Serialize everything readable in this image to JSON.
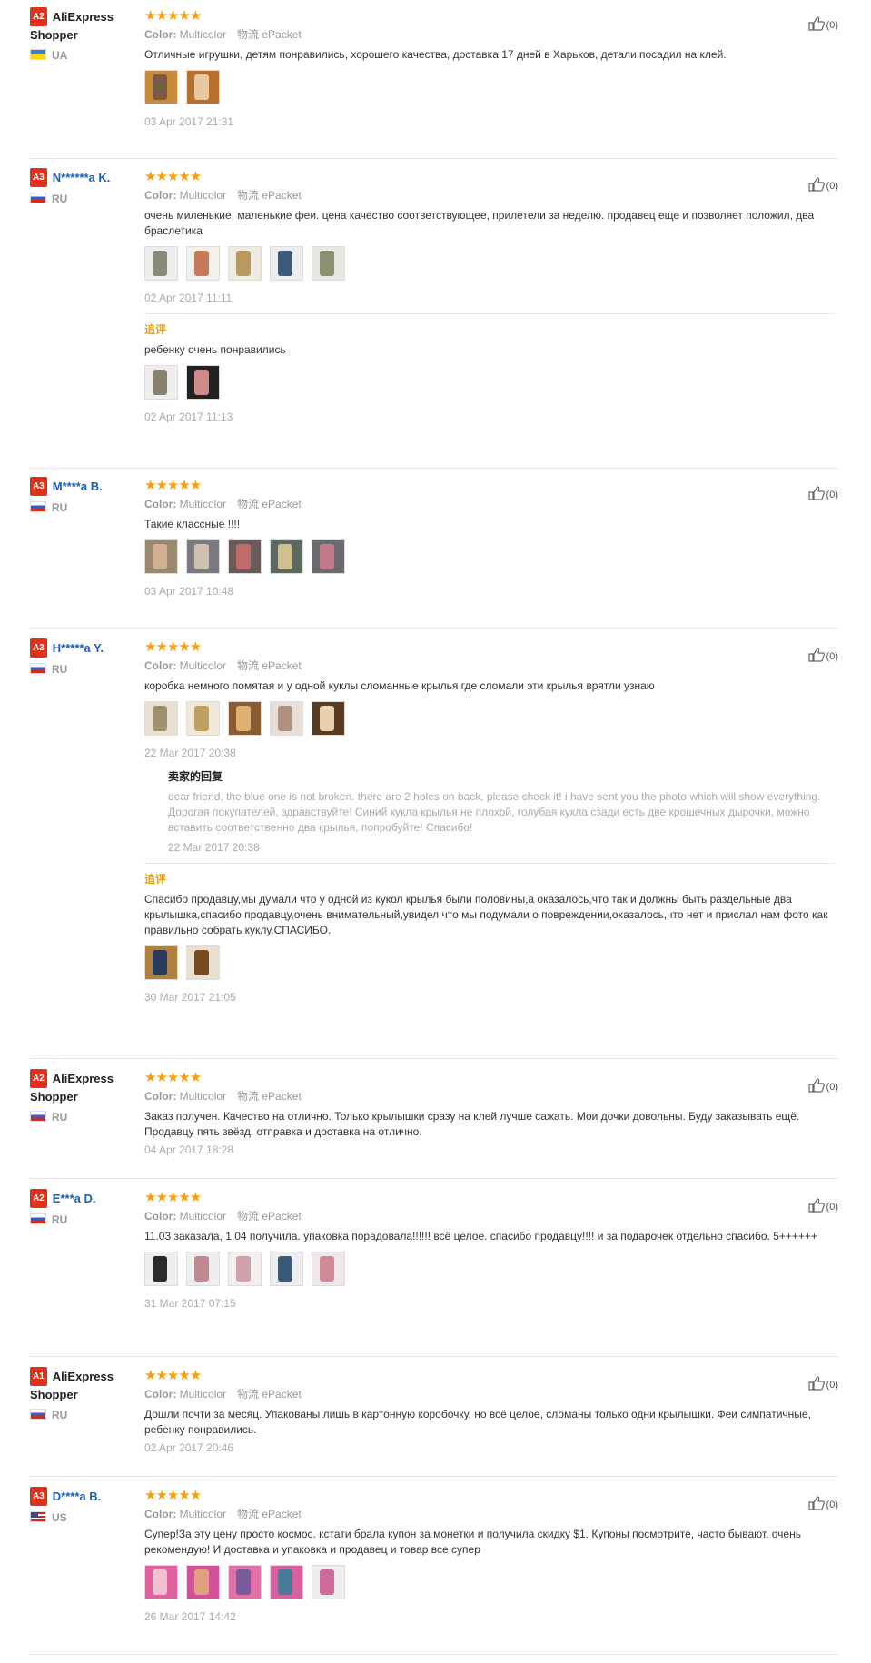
{
  "labels": {
    "color": "Color:",
    "color_value": "Multicolor",
    "logistics": "物流 ePacket",
    "likes": "(0)",
    "additional": "追评",
    "seller_reply": "卖家的回复"
  },
  "reviews": [
    {
      "level": "A2",
      "name": "AliExpress Shopper",
      "country": "UA",
      "text": "Отличные игрушки, детям понравились, хорошего качества, доставка 17 дней в Харьков, детали посадил на клей.",
      "date": "03 Apr 2017 21:31"
    },
    {
      "level": "A3",
      "name": "N******a K.",
      "country": "RU",
      "text": "очень миленькие, маленькие феи. цена качество соответствующее, прилетели за неделю. продавец еще и позволяет положил, два браслетика",
      "date": "02 Apr 2017 11:11",
      "add_text": "ребенку очень понравились",
      "add_date": "02 Apr 2017 11:13"
    },
    {
      "level": "A3",
      "name": "M****a B.",
      "country": "RU",
      "text": "Такие классные !!!!",
      "date": "03 Apr 2017 10:48"
    },
    {
      "level": "A3",
      "name": "H*****a Y.",
      "country": "RU",
      "text": "коробка немного помятая и у одной куклы сломанные крылья где сломали эти крылья врятли узнаю",
      "date": "22 Mar 2017 20:38",
      "reply_text": "dear friend, the blue one is not broken. there are 2 holes on back, please check it! i have sent you the photo which will show everything. Дорогая покупателей, здравствуйте! Синий кукла крылья не плохой, голубая кукла сзади есть две крошечных дырочки, можно вставить соответственно два крылья, попробуйте! Спасибо!",
      "reply_date": "22 Mar 2017 20:38",
      "add_text": "Спасибо продавцу,мы думали что у одной из кукол крылья были половины,а оказалось,что так и должны быть раздельные два крылышка,спасибо продавцу,очень внимательный,увидел что мы подумали о повреждении,оказалось,что нет и прислал нам фото как правильно собрать куклу.СПАСИБО.",
      "add_date": "30 Mar 2017 21:05"
    },
    {
      "level": "A2",
      "name": "AliExpress Shopper",
      "country": "RU",
      "text": "Заказ получен. Качество на отлично. Только крылышки сразу на клей лучше сажать. Мои дочки довольны. Буду заказывать ещё. Продавцу пять звёзд, отправка и доставка на отлично.",
      "date": "04 Apr 2017 18:28"
    },
    {
      "level": "A2",
      "name": "E***a D.",
      "country": "RU",
      "text": "11.03 заказала, 1.04 получила. упаковка порадовала!!!!!! всё целое. спасибо продавцу!!!! и за подарочек отдельно спасибо. 5++++++",
      "date": "31 Mar 2017 07:15"
    },
    {
      "level": "A1",
      "name": "AliExpress Shopper",
      "country": "RU",
      "text": "Дошли почти за месяц. Упакованы лишь в картонную коробочку, но всё целое, сломаны только одни крылышки. Феи симпатичные, ребенку понравились.",
      "date": "02 Apr 2017 20:46"
    },
    {
      "level": "A3",
      "name": "D****a B.",
      "country": "US",
      "text": "Супер!За эту цену просто космос. кстати брала купон за монетки и получила скидку $1. Купоны посмотрите, часто бывают. очень рекомендую! И доставка и упаковка и продавец и товар все супер",
      "date": "26 Mar 2017 14:42"
    }
  ]
}
